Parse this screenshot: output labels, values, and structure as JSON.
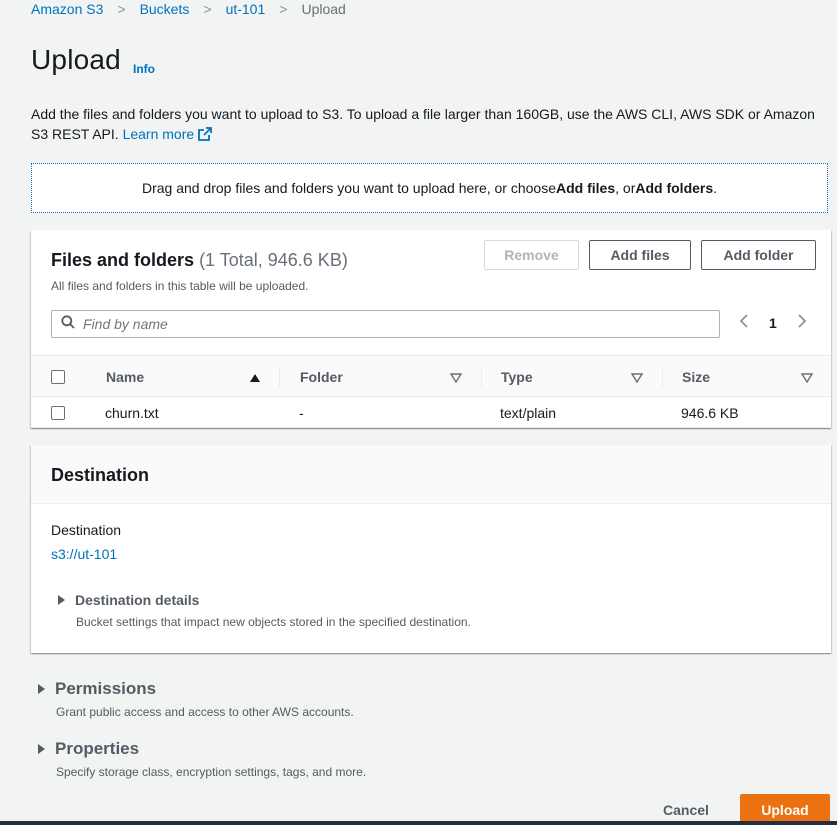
{
  "breadcrumb": {
    "items": [
      "Amazon S3",
      "Buckets",
      "ut-101"
    ],
    "current": "Upload"
  },
  "page": {
    "title": "Upload",
    "info": "Info",
    "intro": "Add the files and folders you want to upload to S3. To upload a file larger than 160GB, use the AWS CLI, AWS SDK or Amazon S3 REST API.",
    "learn_more": "Learn more"
  },
  "dropzone": {
    "text_before": "Drag and drop files and folders you want to upload here, or choose ",
    "add_files": "Add files",
    "text_mid": ", or ",
    "add_folders": "Add folders",
    "text_after": "."
  },
  "files": {
    "title": "Files and folders",
    "count": "(1 Total, 946.6 KB)",
    "subtitle": "All files and folders in this table will be uploaded.",
    "remove_label": "Remove",
    "add_files_label": "Add files",
    "add_folder_label": "Add folder",
    "search_placeholder": "Find by name",
    "page": "1",
    "columns": [
      "Name",
      "Folder",
      "Type",
      "Size"
    ],
    "rows": [
      {
        "name": "churn.txt",
        "folder": "-",
        "type": "text/plain",
        "size": "946.6 KB"
      }
    ]
  },
  "destination": {
    "title": "Destination",
    "label": "Destination",
    "value": "s3://ut-101",
    "details_title": "Destination details",
    "details_sub": "Bucket settings that impact new objects stored in the specified destination."
  },
  "permissions": {
    "title": "Permissions",
    "sub": "Grant public access and access to other AWS accounts."
  },
  "properties": {
    "title": "Properties",
    "sub": "Specify storage class, encryption settings, tags, and more."
  },
  "actions": {
    "cancel": "Cancel",
    "upload": "Upload"
  },
  "colors": {
    "link": "#0073bb",
    "primary_button": "#ec7211",
    "background": "#f2f3f3"
  }
}
